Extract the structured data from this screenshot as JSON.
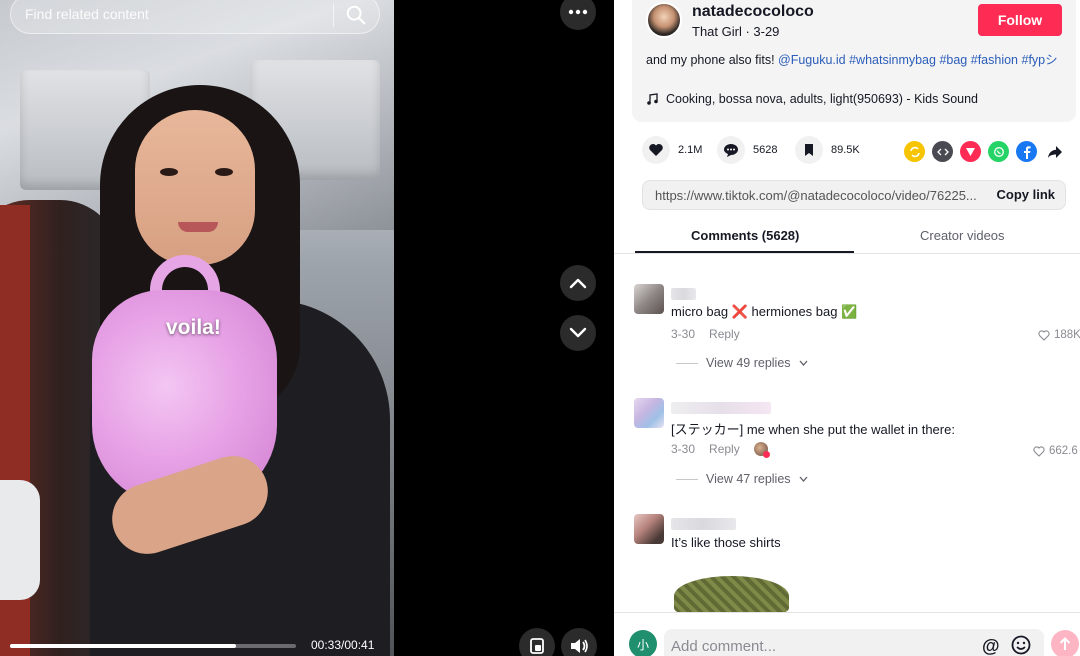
{
  "search": {
    "placeholder": "Find related content"
  },
  "video": {
    "caption": "voila!",
    "time": "00:33/00:41",
    "progress": 0.79
  },
  "author": {
    "name": "natadecocoloco",
    "subline": "That Girl · 3-29",
    "follow_label": "Follow"
  },
  "description": {
    "text": "and my phone also fits! ",
    "tags": [
      "@Fuguku.id",
      "#whatsinmybag",
      "#bag",
      "#fashion",
      "#fypシ"
    ]
  },
  "music": "Cooking, bossa nova, adults, light(950693) - Kids Sound",
  "actions": {
    "likes": "2.1M",
    "comments": "5628",
    "saves": "89.5K",
    "share_icons": [
      "repost-icon",
      "embed-icon",
      "send-icon",
      "whatsapp-icon",
      "facebook-icon",
      "share-arrow-icon"
    ]
  },
  "link": {
    "url": "https://www.tiktok.com/@natadecocoloco/video/76225...",
    "copy_label": "Copy link"
  },
  "tabs": {
    "comments": "Comments (5628)",
    "creator": "Creator videos"
  },
  "comments": [
    {
      "text": "micro bag ❌ hermiones bag ✅",
      "date": "3-30",
      "reply": "Reply",
      "likes": "188K",
      "replies": "View 49 replies"
    },
    {
      "text": "[ステッカー] me when she put the wallet in there:",
      "date": "3-30",
      "reply": "Reply",
      "likes": "662.6",
      "replies": "View 47 replies"
    },
    {
      "text": "It’s like those shirts"
    }
  ],
  "composer": {
    "placeholder": "Add comment...",
    "avatar_letter": "小",
    "at": "@"
  },
  "colors": {
    "accent": "#fe2c55",
    "link": "#2b5db9"
  }
}
